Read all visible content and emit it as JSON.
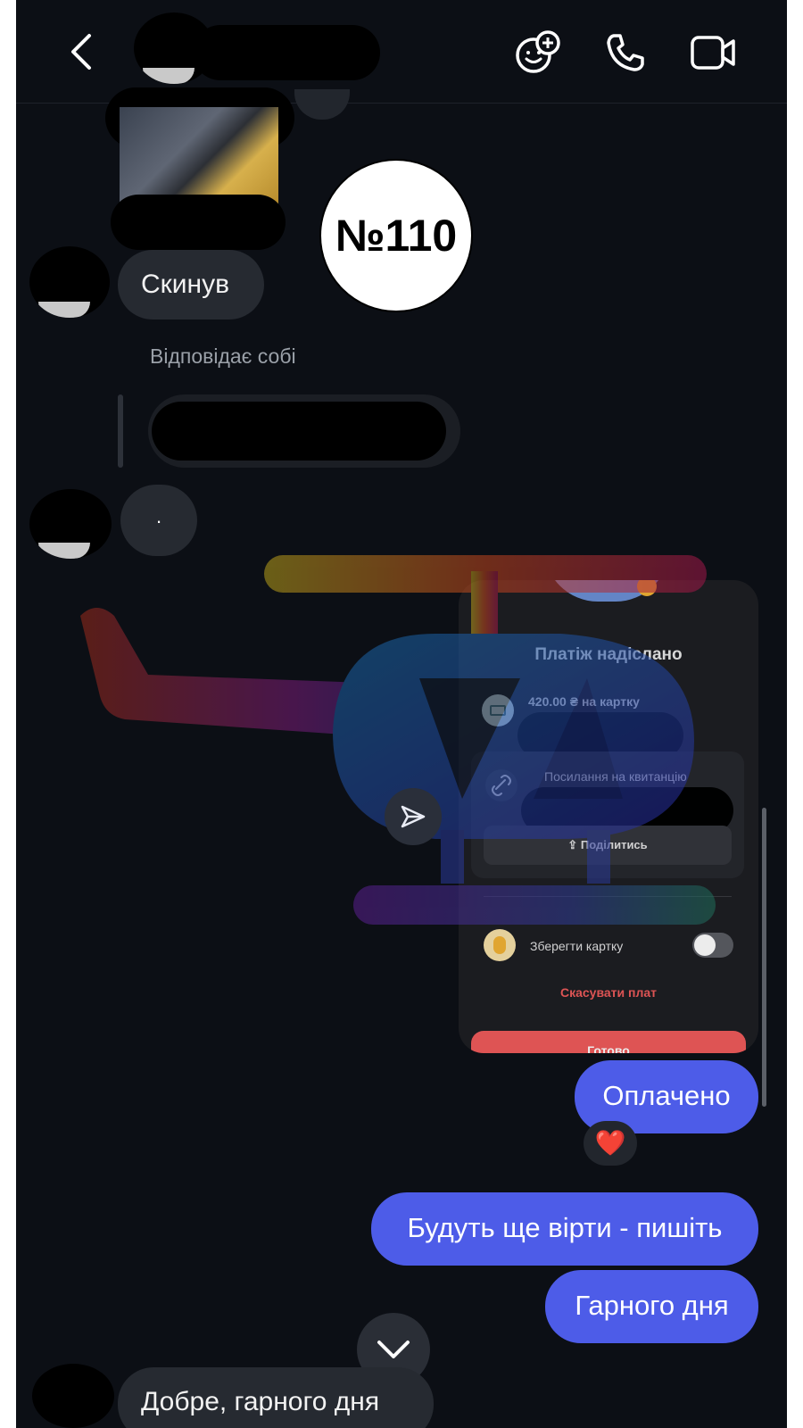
{
  "header": {
    "back_icon": "chevron-left-icon",
    "actions": [
      "add-effect-icon",
      "phone-icon",
      "video-call-icon"
    ]
  },
  "messages": {
    "incoming_1": "Скинув",
    "reply_label": "Відповідає собі",
    "incoming_dot": ".",
    "outgoing_paid": "Оплачено",
    "reaction": "❤️",
    "outgoing_2": "Будуть ще вірти - пишіть",
    "outgoing_3": "Гарного дня",
    "incoming_last": "Добре, гарного дня"
  },
  "stamp": {
    "text": "№110"
  },
  "payment_card": {
    "title": "Платіж надіслано",
    "amount_text": "420.00 ₴ на картку",
    "receipt_link": "Посилання на квитанцію",
    "share": "Поділитись",
    "save_card": "Зберегти картку",
    "cancel": "Скасувати плат",
    "done": "Готово"
  },
  "colors": {
    "background": "#0c0f15",
    "incoming_bubble": "#262a31",
    "outgoing_bubble": "#4d5ce8",
    "cancel_red": "#ef5a5a"
  }
}
